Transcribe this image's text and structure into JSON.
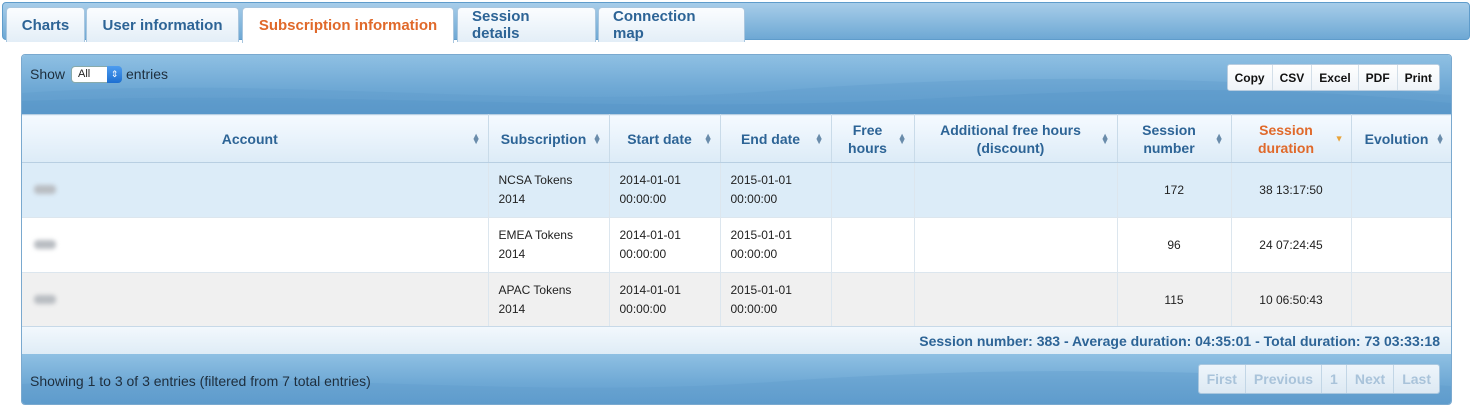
{
  "tabs": [
    {
      "label": "Charts"
    },
    {
      "label": "User information"
    },
    {
      "label": "Subscription information",
      "active": true
    },
    {
      "label": "Session details"
    },
    {
      "label": "Connection map"
    }
  ],
  "length_menu": {
    "show_label": "Show",
    "selected": "All",
    "entries_label": "entries"
  },
  "export_buttons": [
    "Copy",
    "CSV",
    "Excel",
    "PDF",
    "Print"
  ],
  "table": {
    "columns": [
      {
        "label": "Account"
      },
      {
        "label": "Subscription"
      },
      {
        "label": "Start date"
      },
      {
        "label": "End date"
      },
      {
        "label": "Free hours"
      },
      {
        "label": "Additional free hours (discount)"
      },
      {
        "label": "Session number"
      },
      {
        "label": "Session duration",
        "sorted": "desc"
      },
      {
        "label": "Evolution"
      }
    ],
    "rows": [
      {
        "account": "",
        "subscription": "NCSA Tokens 2014",
        "start_date": "2014-01-01 00:00:00",
        "end_date": "2015-01-01 00:00:00",
        "free_hours": "",
        "additional_free_hours": "",
        "session_number": "172",
        "session_duration": "38 13:17:50",
        "evolution": ""
      },
      {
        "account": "",
        "subscription": "EMEA Tokens 2014",
        "start_date": "2014-01-01 00:00:00",
        "end_date": "2015-01-01 00:00:00",
        "free_hours": "",
        "additional_free_hours": "",
        "session_number": "96",
        "session_duration": "24 07:24:45",
        "evolution": ""
      },
      {
        "account": "",
        "subscription": "APAC Tokens 2014",
        "start_date": "2014-01-01 00:00:00",
        "end_date": "2015-01-01 00:00:00",
        "free_hours": "",
        "additional_free_hours": "",
        "session_number": "115",
        "session_duration": "10 06:50:43",
        "evolution": ""
      }
    ]
  },
  "totals": "Session number: 383 - Average duration: 04:35:01 - Total duration: 73 03:33:18",
  "info": "Showing 1 to 3 of 3 entries (filtered from 7 total entries)",
  "pagination": [
    "First",
    "Previous",
    "1",
    "Next",
    "Last"
  ],
  "colors": {
    "accent": "#e0692a",
    "header_text": "#2d6496",
    "toolbar": "#6fa9d5"
  }
}
